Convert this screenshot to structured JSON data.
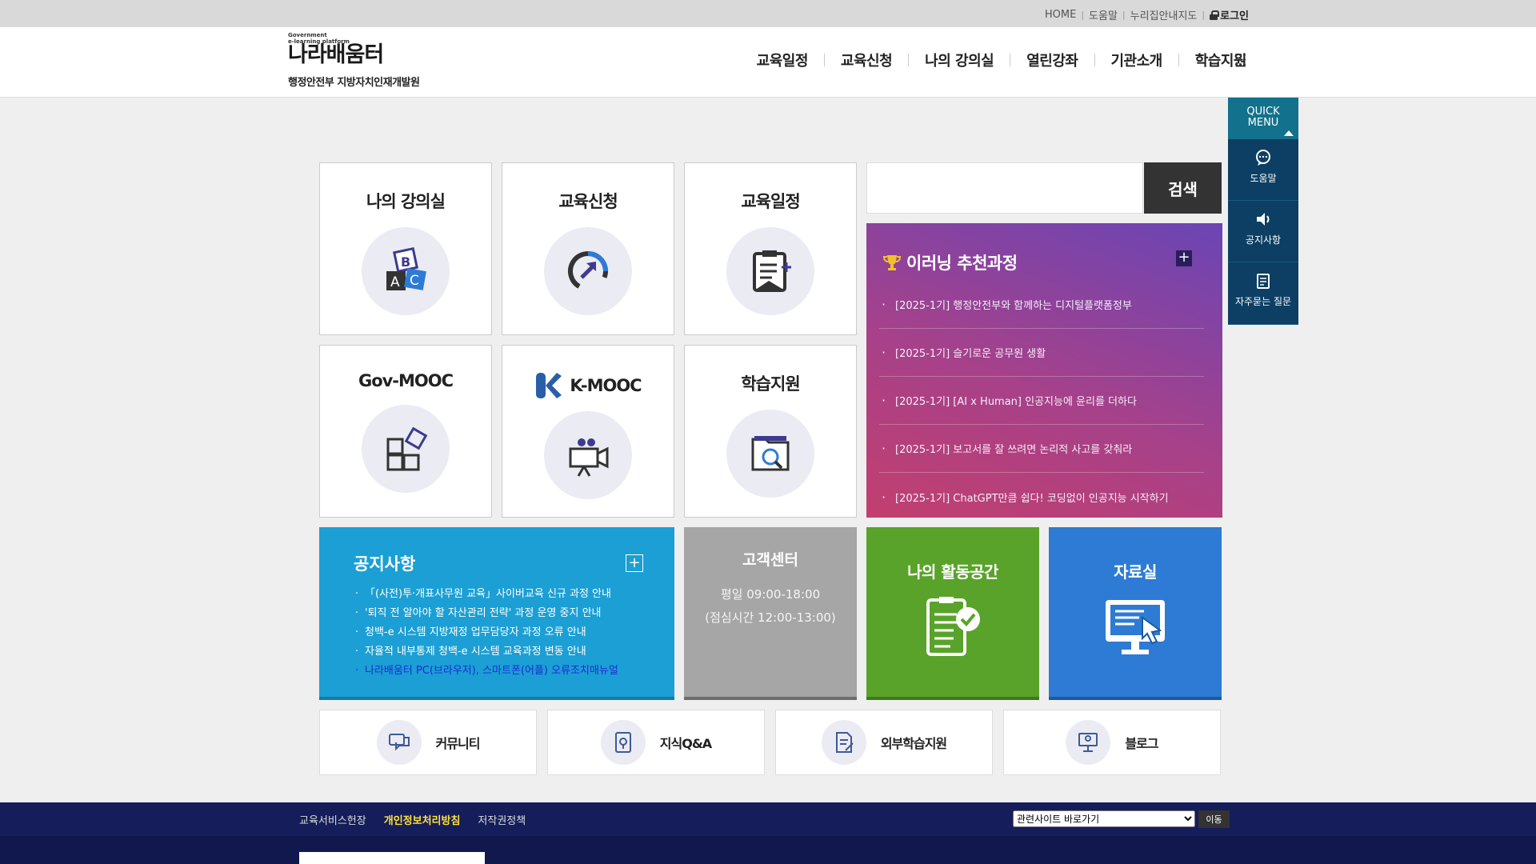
{
  "top_util": {
    "home": "HOME",
    "help": "도움말",
    "sitemap": "누리집안내지도",
    "login": "로그인"
  },
  "logo": {
    "tag1": "Government",
    "tag2": "e-learning platform",
    "brand": "나라배움터",
    "org": "행정안전부 지방자치인재개발원"
  },
  "gnb": [
    "교육일정",
    "교육신청",
    "나의 강의실",
    "열린강좌",
    "기관소개",
    "학습지원"
  ],
  "tiles": {
    "my_class": "나의 강의실",
    "apply": "교육신청",
    "schedule": "교육일정",
    "gov_mooc": "Gov-MOOC",
    "k_mooc": "K-MOOC",
    "support": "학습지원"
  },
  "search": {
    "button": "검색",
    "placeholder": ""
  },
  "elearning": {
    "title": "이러닝 추천과정",
    "plus": "+",
    "items": [
      "[2025-1기] 행정안전부와 함께하는 디지털플랫폼정부",
      "[2025-1기] 슬기로운 공무원 생활",
      "[2025-1기] [AI x Human] 인공지능에 윤리를 더하다",
      "[2025-1기] 보고서를 잘 쓰려면 논리적 사고를 갖춰라",
      "[2025-1기] ChatGPT만큼 쉽다! 코딩없이 인공지능 시작하기"
    ]
  },
  "notice": {
    "title": "공지사항",
    "plus": "+",
    "items": [
      "「(사전)투·개표사무원 교육」사이버교육 신규 과정 안내",
      "'퇴직 전 알아야 할 자산관리 전략' 과정 운영 중지 안내",
      "청백-e 시스템 지방재정 업무담당자 과정 오류 안내",
      "자율적 내부통제 청백-e 시스템 교육과정 변동 안내",
      "나라배움터 PC(브라우저), 스마트폰(어플) 오류조치매뉴얼"
    ]
  },
  "customer_center": {
    "title": "고객센터",
    "hours": "평일 09:00-18:00",
    "lunch": "(점심시간 12:00-13:00)"
  },
  "activity": {
    "title": "나의 활동공간"
  },
  "data_room": {
    "title": "자료실"
  },
  "mini_tiles": [
    "커뮤니티",
    "지식Q&A",
    "외부학습지원",
    "블로그"
  ],
  "quick_menu": {
    "title_line1": "QUICK",
    "title_line2": "MENU",
    "items": [
      "도움말",
      "공지사항",
      "자주묻는 질문"
    ]
  },
  "footer": {
    "links": [
      "교육서비스헌장",
      "개인정보처리방침",
      "저작권정책"
    ],
    "select_value": "관련사이트 바로가기",
    "go": "이동"
  },
  "colors": {
    "elearning_start": "#c23f6e",
    "elearning_end": "#6a45b4",
    "notice": "#1b9fd4",
    "customer": "#a6a6a6",
    "activity": "#5aa32a",
    "data": "#2d7bd4",
    "quick": "#0c3f63",
    "footer": "#10184d"
  }
}
